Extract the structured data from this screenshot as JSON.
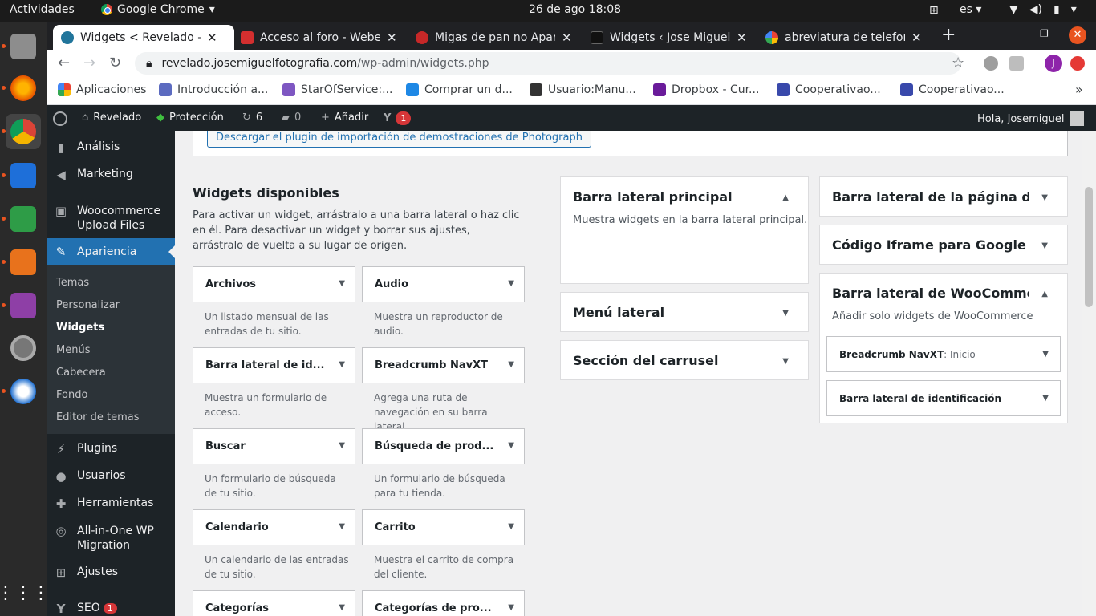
{
  "gnome": {
    "activities": "Actividades",
    "app_name": "Google Chrome",
    "app_arrow": "▾",
    "clock": "26 de ago  18:08",
    "lang": "es ▾"
  },
  "tabs": [
    {
      "title": "Widgets < Revelado —",
      "close": "✕",
      "color": "#21759b"
    },
    {
      "title": "Acceso al foro - Webem",
      "close": "✕",
      "color": "#d32f2f"
    },
    {
      "title": "Migas de pan no Apare",
      "close": "✕",
      "color": "#c62828"
    },
    {
      "title": "Widgets ‹ Jose Miguel",
      "close": "✕",
      "color": "#111111"
    },
    {
      "title": "abreviatura de telefon",
      "close": "✕",
      "color": "#4285f4"
    }
  ],
  "omnibar": {
    "host": "revelado.josemiguelfotografia.com",
    "path": "/wp-admin/widgets.php",
    "profile_letter": "J"
  },
  "bookmarks": [
    {
      "label": "Aplicaciones",
      "color": "#ea4335"
    },
    {
      "label": "Introducción a...",
      "color": "#5c6bc0"
    },
    {
      "label": "StarOfService:...",
      "color": "#7e57c2"
    },
    {
      "label": "Comprar un d...",
      "color": "#1e88e5"
    },
    {
      "label": "Usuario:Manu...",
      "color": "#333333"
    },
    {
      "label": "Dropbox - Cur...",
      "color": "#6a1b9a"
    },
    {
      "label": "Cooperativao...",
      "color": "#3949ab"
    },
    {
      "label": "Cooperativao...",
      "color": "#3949ab"
    }
  ],
  "wpbar": {
    "site": "Revelado",
    "protection": "Protección",
    "updates": "6",
    "comments": "0",
    "add": "Añadir",
    "yoast_badge": "1",
    "greeting": "Hola, Josemiguel"
  },
  "menu": {
    "analisis": "Análisis",
    "marketing": "Marketing",
    "woo_upload_1": "Woocommerce",
    "woo_upload_2": "Upload Files",
    "apariencia": "Apariencia",
    "sub": [
      "Temas",
      "Personalizar",
      "Widgets",
      "Menús",
      "Cabecera",
      "Fondo",
      "Editor de temas"
    ],
    "plugins": "Plugins",
    "usuarios": "Usuarios",
    "herramientas": "Herramientas",
    "aio_1": "All-in-One WP",
    "aio_2": "Migration",
    "ajustes": "Ajustes",
    "seo": "SEO",
    "seo_badge": "1"
  },
  "notice_button": "Descargar el plugin de importación de demostraciones de Photograph",
  "available": {
    "title": "Widgets disponibles",
    "desc": "Para activar un widget, arrástralo a una barra lateral o haz clic en él. Para desactivar un widget y borrar sus ajustes, arrástralo de vuelta a su lugar de origen."
  },
  "widgets": [
    {
      "name": "Archivos",
      "desc": "Un listado mensual de las entradas de tu sitio."
    },
    {
      "name": "Audio",
      "desc": "Muestra un reproductor de audio."
    },
    {
      "name": "Barra lateral de id...",
      "desc": "Muestra un formulario de acceso."
    },
    {
      "name": "Breadcrumb NavXT",
      "desc": "Agrega una ruta de navegación en su barra lateral"
    },
    {
      "name": "Buscar",
      "desc": "Un formulario de búsqueda de tu sitio."
    },
    {
      "name": "Búsqueda de prod...",
      "desc": "Un formulario de búsqueda para tu tienda."
    },
    {
      "name": "Calendario",
      "desc": "Un calendario de las entradas de tu sitio."
    },
    {
      "name": "Carrito",
      "desc": "Muestra el carrito de compra del cliente."
    },
    {
      "name": "Categorías",
      "desc": ""
    },
    {
      "name": "Categorías de pro...",
      "desc": ""
    }
  ],
  "sidebars_mid": [
    {
      "title": "Barra lateral principal",
      "desc": "Muestra widgets en la barra lateral principal."
    },
    {
      "title": "Menú lateral"
    },
    {
      "title": "Sección del carrusel"
    }
  ],
  "sidebars_right": [
    {
      "title": "Barra lateral de la página de co"
    },
    {
      "title": "Código Iframe para Google ma"
    },
    {
      "title": "Barra lateral de WooCommerce",
      "desc": "Añadir solo widgets de WooCommerce"
    }
  ],
  "woo_widgets": [
    {
      "name": "Breadcrumb NavXT",
      "suffix": ": Inicio"
    },
    {
      "name": "Barra lateral de identificación",
      "suffix": ""
    }
  ]
}
